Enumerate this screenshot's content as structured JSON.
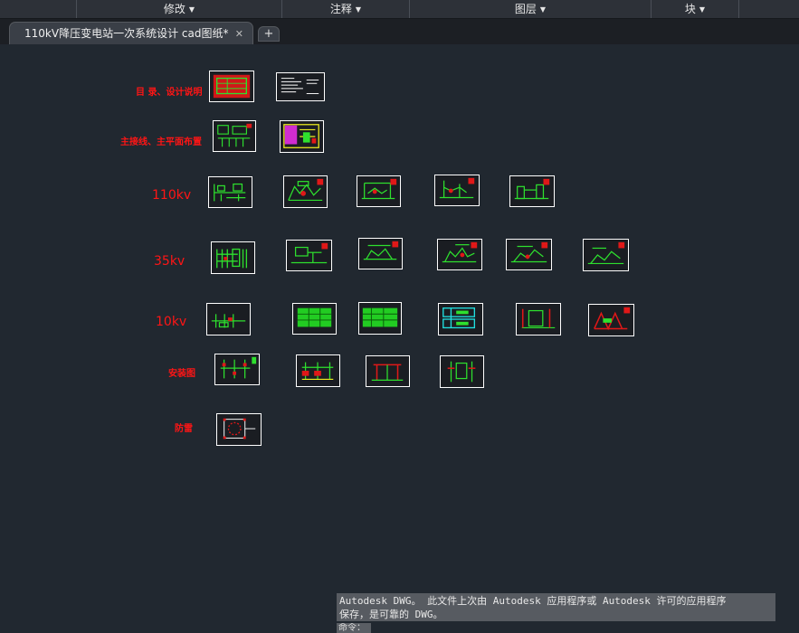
{
  "ribbon": {
    "panels": [
      {
        "label": "修改"
      },
      {
        "label": "注释"
      },
      {
        "label": "图层"
      },
      {
        "label": "块"
      }
    ]
  },
  "tabs": {
    "active_label": "110kV降压变电站一次系统设计 cad图纸*",
    "close_glyph": "✕",
    "new_glyph": "+"
  },
  "drawing": {
    "row_labels": [
      "目 录、设计说明",
      "主接线、主平面布置",
      "110kv",
      "35kv",
      "10kv",
      "安装图",
      "防雷"
    ]
  },
  "command": {
    "history_line1": "Autodesk DWG。  此文件上次由 Autodesk 应用程序或 Autodesk 许可的应用程序",
    "history_line2": "保存，是可靠的 DWG。",
    "prompt": "命令："
  }
}
